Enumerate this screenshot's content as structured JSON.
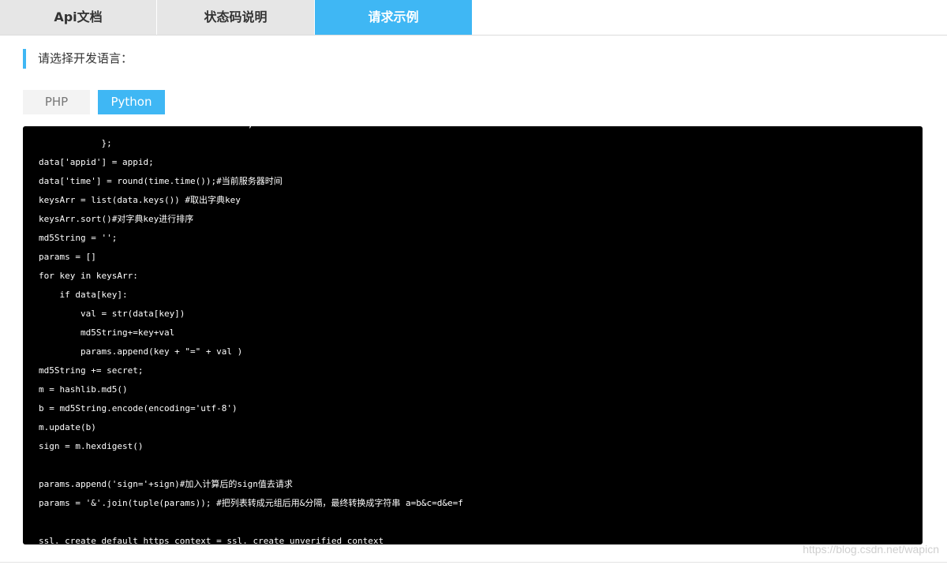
{
  "tabs": [
    {
      "label": "Api文档",
      "active": false
    },
    {
      "label": "状态码说明",
      "active": false
    },
    {
      "label": "请求示例",
      "active": true
    }
  ],
  "language_prompt": "请选择开发语言：",
  "languages": [
    {
      "label": "PHP",
      "active": false
    },
    {
      "label": "Python",
      "active": true
    }
  ],
  "code_lines": [
    "                                        ,",
    "            };",
    "data['appid'] = appid;",
    "data['time'] = round(time.time());#当前服务器时间",
    "keysArr = list(data.keys()) #取出字典key",
    "keysArr.sort()#对字典key进行排序",
    "md5String = '';",
    "params = []",
    "for key in keysArr:",
    "    if data[key]:",
    "        val = str(data[key])",
    "        md5String+=key+val",
    "        params.append(key + \"=\" + val )",
    "md5String += secret;",
    "m = hashlib.md5()",
    "b = md5String.encode(encoding='utf-8')",
    "m.update(b)",
    "sign = m.hexdigest()",
    "",
    "params.append('sign='+sign)#加入计算后的sign值去请求",
    "params = '&'.join(tuple(params)); #把列表转成元组后用&分隔，最终转换成字符串 a=b&c=d&e=f",
    "",
    "ssl._create_default_https_context = ssl._create_unverified_context"
  ],
  "watermark": "https://blog.csdn.net/wapicn",
  "colors": {
    "accent": "#3fb7f4",
    "tab_inactive": "#e6e6e6",
    "code_bg": "#000000"
  }
}
